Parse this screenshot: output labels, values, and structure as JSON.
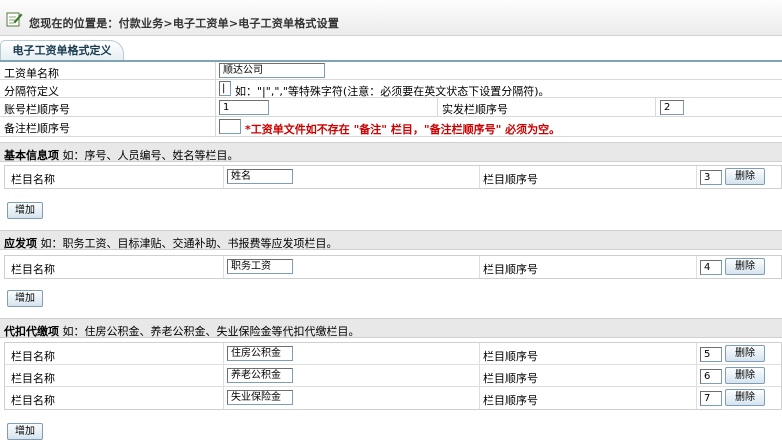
{
  "breadcrumb": {
    "text": "您现在的位置是：付款业务>电子工资单>电子工资单格式设置"
  },
  "tab": {
    "label": "电子工资单格式定义"
  },
  "form": {
    "name_label": "工资单名称",
    "name_value": "顺达公司",
    "separator_label": "分隔符定义",
    "separator_value": "|",
    "separator_hint": "如：\"|\",\",\"等特殊字符(注意：必须要在英文状态下设置分隔符)。",
    "account_label": "账号栏顺序号",
    "account_value": "1",
    "actual_label": "实发栏顺序号",
    "actual_value": "2",
    "remark_label": "备注栏顺序号",
    "remark_value": "",
    "remark_hint": "*工资单文件如不存在 \"备注\" 栏目，\"备注栏顺序号\" 必须为空。"
  },
  "sections": {
    "basic": {
      "title": "基本信息项",
      "desc": "如：序号、人员编号、姓名等栏目。",
      "rows": [
        {
          "name_label": "栏目名称",
          "name_value": "姓名",
          "seq_label": "栏目顺序号",
          "seq_value": "3",
          "delete_label": "删除"
        }
      ],
      "add_label": "增加"
    },
    "payable": {
      "title": "应发项",
      "desc": "如：职务工资、目标津贴、交通补助、书报费等应发项栏目。",
      "rows": [
        {
          "name_label": "栏目名称",
          "name_value": "职务工资",
          "seq_label": "栏目顺序号",
          "seq_value": "4",
          "delete_label": "删除"
        }
      ],
      "add_label": "增加"
    },
    "deduction": {
      "title": "代扣代缴项",
      "desc": "如：住房公积金、养老公积金、失业保险金等代扣代缴栏目。",
      "rows": [
        {
          "name_label": "栏目名称",
          "name_value": "住房公积金",
          "seq_label": "栏目顺序号",
          "seq_value": "5",
          "delete_label": "删除"
        },
        {
          "name_label": "栏目名称",
          "name_value": "养老公积金",
          "seq_label": "栏目顺序号",
          "seq_value": "6",
          "delete_label": "删除"
        },
        {
          "name_label": "栏目名称",
          "name_value": "失业保险金",
          "seq_label": "栏目顺序号",
          "seq_value": "7",
          "delete_label": "删除"
        }
      ],
      "add_label": "增加"
    }
  },
  "icons": {
    "breadcrumb": "edit-document-icon"
  },
  "colors": {
    "warning": "#cc0000",
    "tab_accent": "#7fa4b6"
  }
}
